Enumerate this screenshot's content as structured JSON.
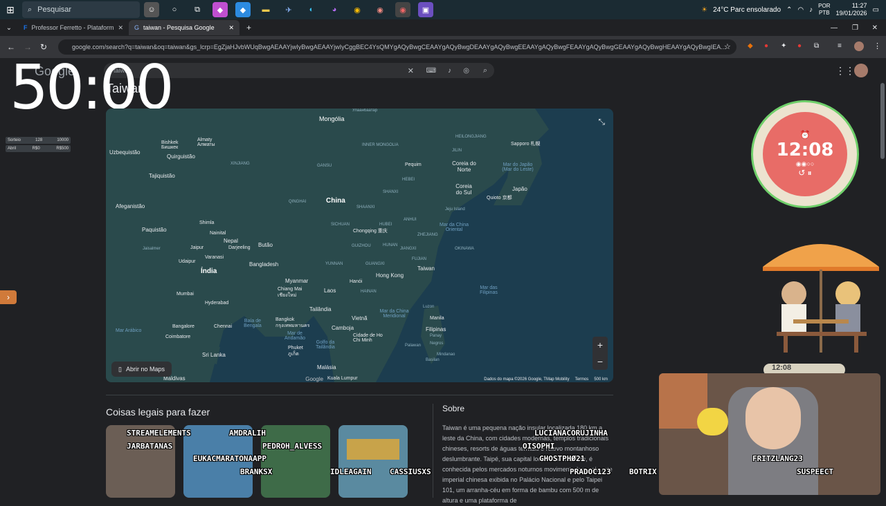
{
  "taskbar": {
    "search_label": "Pesquisar",
    "weather": "24°C  Parc ensolarado",
    "lang": "POR",
    "lang2": "PTB",
    "time": "11:27",
    "date": "19/01/2026"
  },
  "tabs": [
    {
      "label": "Professor Ferretto - Plataforma"
    },
    {
      "label": "taiwan - Pesquisa Google"
    }
  ],
  "address": {
    "url": "google.com/search?q=taiwan&oq=taiwan&gs_lcrp=EgZjaHJvbWUqBwgAEAAYjwIyBwgAEAAYjwIyCggBEC4YsQMYgAQyBwgCEAAYgAQyBwgDEAAYgAQyBwgEEAAYgAQyBwgFEAAYgAQyBwgGEAAYgAQyBwgHEAAYgAQyBwgIEA..."
  },
  "google": {
    "logo": "Google",
    "query": "taiwan",
    "title": "Taiwan"
  },
  "timer": "50:00",
  "stats": [
    {
      "a": "Sorteio",
      "b": "128",
      "c": "10000"
    },
    {
      "a": "Abril",
      "b": "R$0",
      "c": "R$500"
    }
  ],
  "map": {
    "countries": [
      {
        "name": "Mongólia"
      },
      {
        "name": "China"
      },
      {
        "name": "Índia"
      },
      {
        "name": "Japão"
      },
      {
        "name": "Coreia do Norte"
      },
      {
        "name": "Coreia do Sul"
      },
      {
        "name": "Taiwan"
      },
      {
        "name": "Filipinas"
      },
      {
        "name": "Uzbequistão"
      },
      {
        "name": "Quirguistão"
      },
      {
        "name": "Tajiquistão"
      },
      {
        "name": "Afeganistão"
      },
      {
        "name": "Paquistão"
      },
      {
        "name": "Nepal"
      },
      {
        "name": "Butão"
      },
      {
        "name": "Bangladesh"
      },
      {
        "name": "Myanmar"
      },
      {
        "name": "Laos"
      },
      {
        "name": "Tailândia"
      },
      {
        "name": "Vietnã"
      },
      {
        "name": "Camboja"
      },
      {
        "name": "Sri Lanka"
      },
      {
        "name": "Malásia"
      },
      {
        "name": "Maldivas"
      }
    ],
    "cities": [
      {
        "name": "Улаанбаатар"
      },
      {
        "name": "Pequim"
      },
      {
        "name": "Sapporo 札幌"
      },
      {
        "name": "Quioto 京都"
      },
      {
        "name": "Hong Kong"
      },
      {
        "name": "Chongqing 重庆"
      },
      {
        "name": "Hanói"
      },
      {
        "name": "Manila"
      },
      {
        "name": "Bangkok กรุงเทพมหานคร"
      },
      {
        "name": "Cidade de Ho Chi Minh"
      },
      {
        "name": "Mumbai"
      },
      {
        "name": "Hyderabad"
      },
      {
        "name": "Bangalore"
      },
      {
        "name": "Chennai"
      },
      {
        "name": "Coimbatore"
      },
      {
        "name": "Kuala Lumpur"
      },
      {
        "name": "Bishkek Бишкек"
      },
      {
        "name": "Almaty Алматы"
      },
      {
        "name": "Shimla"
      },
      {
        "name": "Nainital"
      },
      {
        "name": "Jaipur"
      },
      {
        "name": "Udaipur"
      },
      {
        "name": "Varanasi"
      },
      {
        "name": "Darjeeling"
      },
      {
        "name": "Chiang Mai เชียงใหม่"
      },
      {
        "name": "Phuket ภูเก็ต"
      },
      {
        "name": "Jaisalmer"
      },
      {
        "name": "Jeju Island"
      }
    ],
    "waters": [
      {
        "name": "Mar do Japão (Mar do Leste)"
      },
      {
        "name": "Mar da China Oriental"
      },
      {
        "name": "Mar da China Meridional"
      },
      {
        "name": "Mar das Filipinas"
      },
      {
        "name": "Baía de Bengala"
      },
      {
        "name": "Mar Arábico"
      },
      {
        "name": "Mar de Andamão"
      },
      {
        "name": "Golfo da Tailândia"
      }
    ],
    "regions": [
      {
        "name": "XINJIANG"
      },
      {
        "name": "GANSU"
      },
      {
        "name": "INNER MONGOLIA"
      },
      {
        "name": "QINGHAI"
      },
      {
        "name": "SICHUAN"
      },
      {
        "name": "YUNNAN"
      },
      {
        "name": "GUANGXI"
      },
      {
        "name": "HUNAN"
      },
      {
        "name": "JIANGXI"
      },
      {
        "name": "FUJIAN"
      },
      {
        "name": "ZHEJIANG"
      },
      {
        "name": "ANHUI"
      },
      {
        "name": "SHANXI"
      },
      {
        "name": "HEBEI"
      },
      {
        "name": "HEILONGJIANG"
      },
      {
        "name": "JILIN"
      },
      {
        "name": "GUIZHOU"
      },
      {
        "name": "HUBEI"
      },
      {
        "name": "SHAANXI"
      },
      {
        "name": "OKINAWA"
      },
      {
        "name": "HAINAN"
      },
      {
        "name": "Luzon"
      },
      {
        "name": "Negros"
      },
      {
        "name": "Mindanao"
      },
      {
        "name": "Palawan"
      },
      {
        "name": "Basilan"
      },
      {
        "name": "Panay"
      }
    ],
    "open_label": "Abrir no Maps",
    "attribution": "Dados do mapa ©2026 Google, TMap Mobility",
    "terms": "Termos",
    "scale": "500 km"
  },
  "things_title": "Coisas legais para fazer",
  "sobre": {
    "title": "Sobre",
    "text": "Taiwan é uma pequena nação insular localizada 180 km a leste da China, com cidades modernas, templos tradicionais chineses, resorts de águas termais e relevo montanhoso deslumbrante. Taipé, sua capital localizada no norte, é conhecida pelos mercados noturnos movimentados, pela arte imperial chinesa exibida no Palácio Nacional e pelo Taipei 101, um arranha-céu em forma de bambu com 500 m de altura e uma plataforma de"
  },
  "pomodoro": {
    "time": "12:08"
  },
  "pomo_small": "12:08",
  "nicks": [
    {
      "name": "STREAMELEMENTS"
    },
    {
      "name": "JARBATANAS"
    },
    {
      "name": "AMDRALIH"
    },
    {
      "name": "PEDROH_ALVESS"
    },
    {
      "name": "EUKACMARATONAAPP"
    },
    {
      "name": "BRANKSX"
    },
    {
      "name": "IDLEAGAIN"
    },
    {
      "name": "CASSIUSXS"
    },
    {
      "name": "LUCIANACORUJINHA"
    },
    {
      "name": "OISOPHI"
    },
    {
      "name": "GHOSTPHØ21"
    },
    {
      "name": "PRADOC123"
    },
    {
      "name": "BOTRIX"
    },
    {
      "name": "FRITZLANG23"
    },
    {
      "name": "SUSPEECT"
    }
  ],
  "colors": {
    "map_sea": "#1c3d4f",
    "map_land": "#2a4a4c",
    "pomo_red": "#e86c67",
    "ring_green": "#6fcf6a"
  }
}
